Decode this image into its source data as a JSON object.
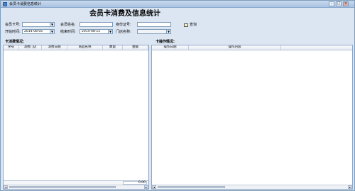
{
  "window": {
    "title": "会员卡消费信息统计"
  },
  "heading": "会员卡消费及信息统计",
  "filters": {
    "card_no_label": "会员卡号:",
    "card_no_value": "",
    "member_name_label": "会员姓名:",
    "member_name_value": "",
    "id_card_label": "身份证号:",
    "id_card_value": "",
    "start_time_label": "开始时间:",
    "start_time_value": "2014-08-05",
    "end_time_label": "结束时间:",
    "end_time_value": "2014-08-15",
    "store_label": "门店名称:",
    "store_value": ""
  },
  "query_button": "查询",
  "consumption": {
    "title": "卡消费情况:",
    "columns": [
      "序号",
      "消费门店",
      "消费日期",
      "商品名称",
      "数量",
      "金额"
    ],
    "total": "0.00"
  },
  "operations": {
    "title": "卡操作情况:",
    "columns": [
      "操作日期",
      "操作内容"
    ]
  }
}
